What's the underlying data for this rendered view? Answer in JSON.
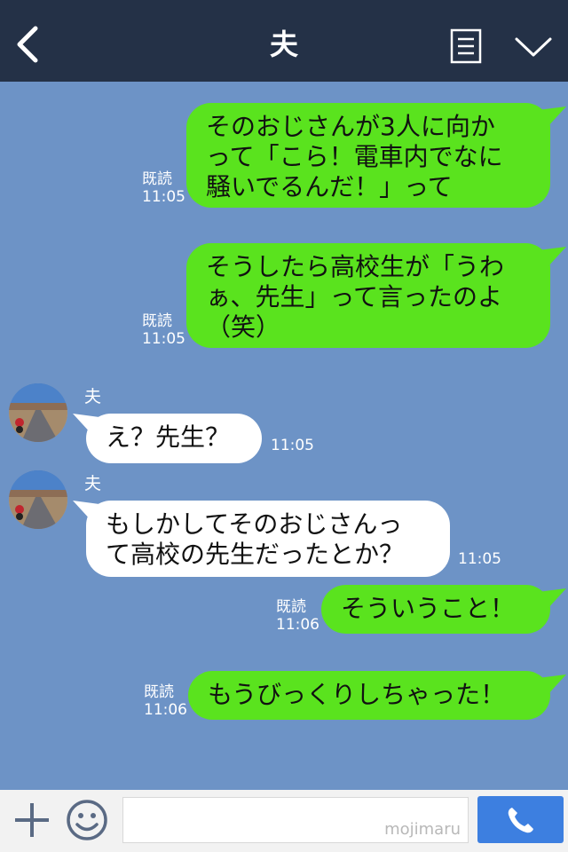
{
  "header": {
    "title": "夫"
  },
  "messages": [
    {
      "type": "sent",
      "text": "そのおじさんが3人に向か\nって「こら！電車内でなに\n騒いでるんだ！」って",
      "read": "既読",
      "time": "11:05"
    },
    {
      "type": "sent",
      "text": "そうしたら高校生が「うわ\nぁ、先生」って言ったのよ\n（笑）",
      "read": "既読",
      "time": "11:05"
    },
    {
      "type": "recv",
      "sender": "夫",
      "text": "え？先生？",
      "time": "11:05"
    },
    {
      "type": "recv",
      "sender": "夫",
      "text": "もしかしてそのおじさんっ\nて高校の先生だったとか？",
      "time": "11:05"
    },
    {
      "type": "sent",
      "text": "そういうこと！",
      "read": "既読",
      "time": "11:06"
    },
    {
      "type": "sent",
      "text": "もうびっくりしちゃった！",
      "read": "既読",
      "time": "11:06"
    }
  ],
  "footer": {
    "watermark": "mojimaru"
  },
  "colors": {
    "header_bg": "#243147",
    "chat_bg": "#6d93c6",
    "sent_bubble": "#5ae31e",
    "recv_bubble": "#ffffff",
    "call_button": "#3d7fe0"
  },
  "icons": {
    "back": "chevron-left-icon",
    "notes": "notes-icon",
    "menu": "chevron-down-icon",
    "add": "plus-icon",
    "emoji": "smiley-icon",
    "call": "phone-icon"
  }
}
